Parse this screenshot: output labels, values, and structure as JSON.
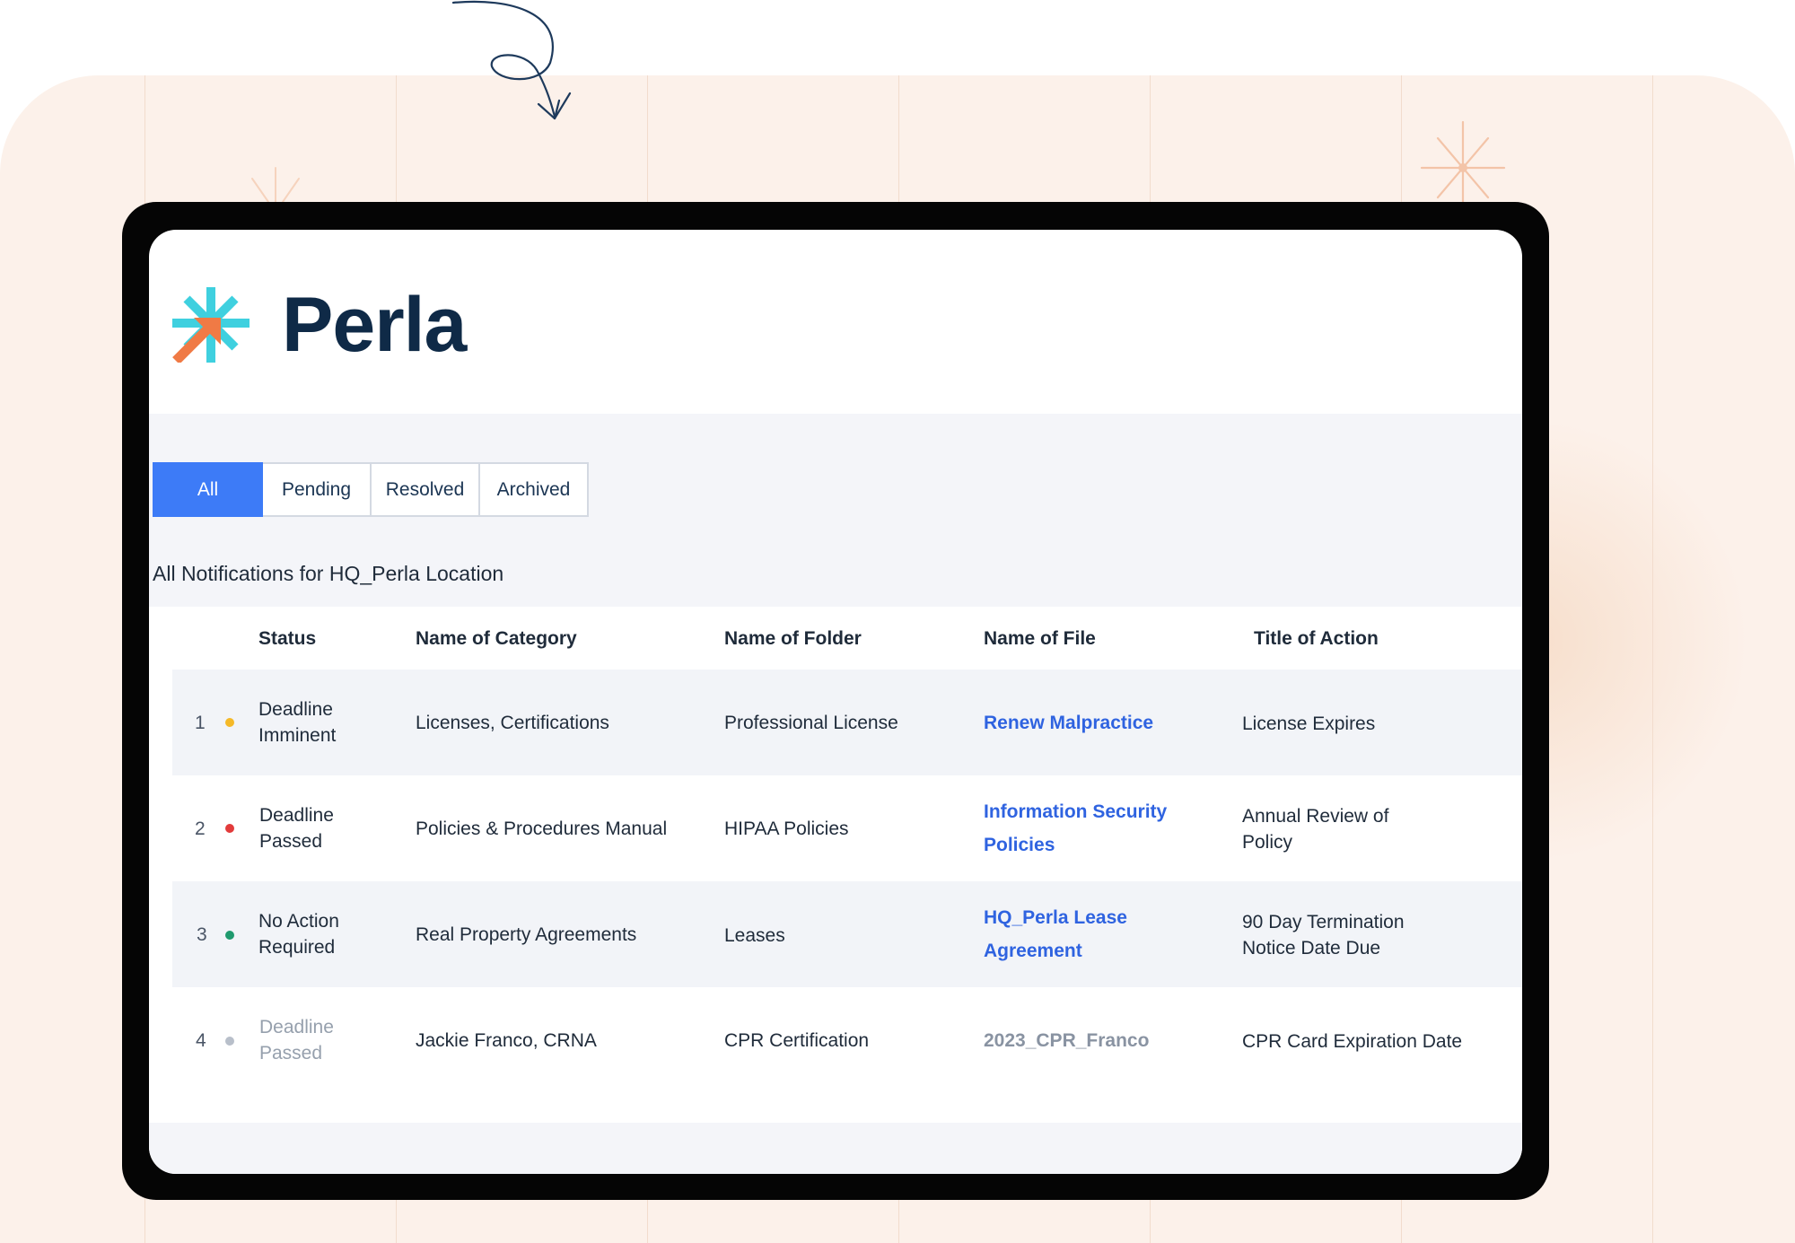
{
  "app": {
    "name": "Perla"
  },
  "tabs": [
    {
      "label": "All",
      "active": true
    },
    {
      "label": "Pending",
      "active": false
    },
    {
      "label": "Resolved",
      "active": false
    },
    {
      "label": "Archived",
      "active": false
    }
  ],
  "section_title": "All Notifications for HQ_Perla Location",
  "table": {
    "columns": [
      "Status",
      "Name of Category",
      "Name of Folder",
      "Name of File",
      "Title of Action"
    ],
    "rows": [
      {
        "number": "1",
        "status_line1": "Deadline",
        "status_line2": "Imminent",
        "status_color": "#f5b928",
        "category": "Licenses, Certifications",
        "folder": "Professional License",
        "file_line1": "Renew Malpractice",
        "file_line2": "",
        "action_line1": "License Expires",
        "action_line2": ""
      },
      {
        "number": "2",
        "status_line1": "Deadline",
        "status_line2": "Passed",
        "status_color": "#e23b3b",
        "category": "Policies & Procedures Manual",
        "folder": "HIPAA Policies",
        "file_line1": "Information Security",
        "file_line2": "Policies",
        "action_line1": "Annual Review of",
        "action_line2": "Policy"
      },
      {
        "number": "3",
        "status_line1": "No Action",
        "status_line2": "Required",
        "status_color": "#1f9a6e",
        "category": "Real Property Agreements",
        "folder": "Leases",
        "file_line1": "HQ_Perla Lease",
        "file_line2": "Agreement",
        "action_line1": "90 Day Termination",
        "action_line2": "Notice Date Due"
      },
      {
        "number": "4",
        "status_line1": "Deadline",
        "status_line2": "Passed",
        "status_color": "#b8bfca",
        "category": "Jackie Franco, CRNA",
        "folder": "CPR Certification",
        "file_line1": "2023_CPR_Franco",
        "file_line2": "",
        "action_line1": "CPR Card Expiration Date",
        "action_line2": ""
      }
    ]
  },
  "colors": {
    "accent": "#3d7bf7",
    "brand_navy": "#0f2a47",
    "link": "#2f63e0",
    "logo_teal": "#3fd0df",
    "logo_orange": "#f07a45",
    "background": "#fcf1ea"
  },
  "icons": [
    "perla-logo-icon",
    "sparkle-star-icon",
    "curly-arrow-icon",
    "status-dot-icon"
  ]
}
